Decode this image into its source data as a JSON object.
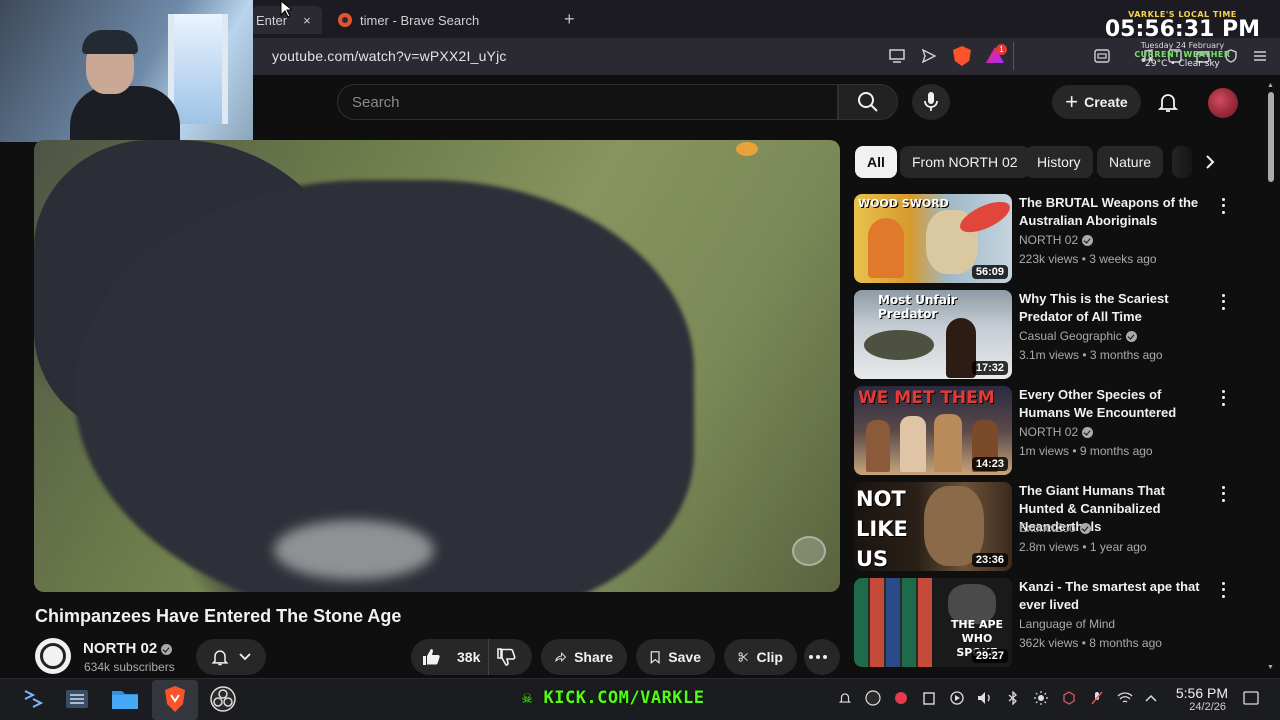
{
  "browser": {
    "tabs": [
      {
        "label": "Enter",
        "active": true
      },
      {
        "label": "timer - Brave Search",
        "active": false
      }
    ],
    "new_tab": "+",
    "close": "×",
    "url": "youtube.com/watch?v=wPXX2I_uYjc",
    "rewards_badge": "1"
  },
  "stream_overlay": {
    "clock_label": "VARKLE'S LOCAL TIME",
    "clock_time": "05:56:31 PM",
    "clock_date": "Tuesday 24 February",
    "weather_label": "CURRENT WEATHER",
    "weather": "29°C • Clear sky",
    "kick": "KICK.COM/VARKLE"
  },
  "masthead": {
    "search_placeholder": "Search",
    "create_label": "Create"
  },
  "video": {
    "title": "Chimpanzees Have Entered The Stone Age",
    "channel": "NORTH 02",
    "subscribers": "634k subscribers",
    "likes": "38k",
    "share": "Share",
    "save": "Save",
    "clip": "Clip"
  },
  "chips": [
    "All",
    "From NORTH 02",
    "History",
    "Nature"
  ],
  "recommendations": [
    {
      "title": "The BRUTAL Weapons of the Australian Aboriginals",
      "channel": "NORTH 02",
      "verified": true,
      "meta": "223k views • 3 weeks ago",
      "duration": "56:09",
      "thumb_text": "WOOD SWORD"
    },
    {
      "title": "Why This is the Scariest Predator of All Time",
      "channel": "Casual Geographic",
      "verified": true,
      "meta": "3.1m views • 3 months ago",
      "duration": "17:32",
      "thumb_text": "Most Unfair Predator"
    },
    {
      "title": "Every Other Species of Humans We Encountered",
      "channel": "NORTH 02",
      "verified": true,
      "meta": "1m views • 9 months ago",
      "duration": "14:23",
      "thumb_text": "WE MET THEM"
    },
    {
      "title": "The Giant Humans That Hunted & Cannibalized Neanderthals",
      "channel": "ExtinctZoo",
      "verified": true,
      "meta": "2.8m views • 1 year ago",
      "duration": "23:36",
      "thumb_text": "NOT LIKE US"
    },
    {
      "title": "Kanzi - The smartest ape that ever lived",
      "channel": "Language of Mind",
      "verified": false,
      "meta": "362k views • 8 months ago",
      "duration": "29:27",
      "thumb_text": "THE APE WHO SPOKE"
    }
  ],
  "taskbar": {
    "time": "5:56 PM",
    "date": "24/2/26"
  }
}
